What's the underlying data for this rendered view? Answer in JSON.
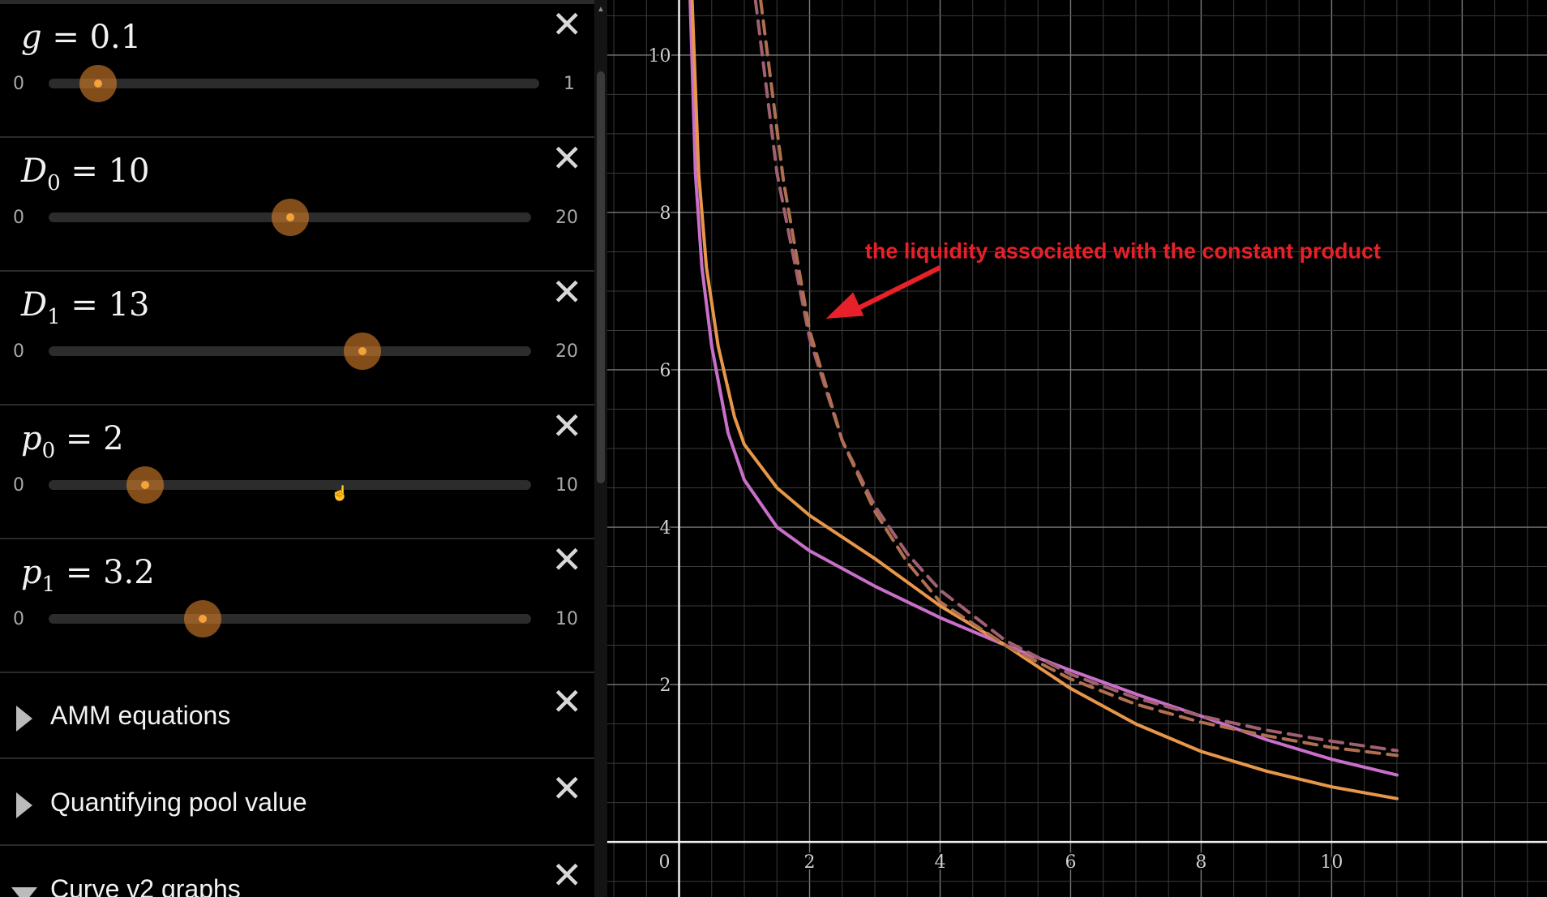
{
  "sliders": [
    {
      "var": "g",
      "sub": "",
      "value": "0.1",
      "min": "0",
      "max": "1",
      "level": 0.1
    },
    {
      "var": "D",
      "sub": "0",
      "value": "10",
      "min": "0",
      "max": "20",
      "level": 0.5
    },
    {
      "var": "D",
      "sub": "1",
      "value": "13",
      "min": "0",
      "max": "20",
      "level": 0.65
    },
    {
      "var": "p",
      "sub": "0",
      "value": "2",
      "min": "0",
      "max": "10",
      "level": 0.2
    },
    {
      "var": "p",
      "sub": "1",
      "value": "3.2",
      "min": "0",
      "max": "10",
      "level": 0.32
    }
  ],
  "folders": [
    {
      "title": "AMM equations",
      "expanded": false
    },
    {
      "title": "Quantifying pool value",
      "expanded": false
    },
    {
      "title": "Curve v2 graphs",
      "expanded": true
    }
  ],
  "icons": {
    "delete": "close-x-icon",
    "collapse": "triangle-icon",
    "cursor": "hand-cursor-icon"
  },
  "annotation": {
    "text": "the liquidity associated with the constant product",
    "color": "#e8202a"
  },
  "chart_data": {
    "type": "line",
    "xlim": [
      -1.1,
      13.3
    ],
    "ylim": [
      -0.7,
      10.7
    ],
    "x_ticks": [
      "0",
      "2",
      "4",
      "6",
      "8",
      "10"
    ],
    "y_ticks": [
      "2",
      "4",
      "6",
      "8",
      "10"
    ],
    "grid": true,
    "series": [
      {
        "color": "#c86fc9",
        "style": "solid",
        "points": [
          [
            0.17,
            10.7
          ],
          [
            0.25,
            8.5
          ],
          [
            0.35,
            7.3
          ],
          [
            0.5,
            6.3
          ],
          [
            0.75,
            5.2
          ],
          [
            1.0,
            4.6
          ],
          [
            1.5,
            4.0
          ],
          [
            2.0,
            3.7
          ],
          [
            3.0,
            3.25
          ],
          [
            4.0,
            2.85
          ],
          [
            5.0,
            2.5
          ],
          [
            6.0,
            2.18
          ],
          [
            7.0,
            1.88
          ],
          [
            8.0,
            1.6
          ],
          [
            9.0,
            1.3
          ],
          [
            10.0,
            1.05
          ],
          [
            11.0,
            0.85
          ]
        ]
      },
      {
        "color": "#e8974a",
        "style": "solid",
        "points": [
          [
            0.2,
            10.7
          ],
          [
            0.3,
            8.5
          ],
          [
            0.42,
            7.3
          ],
          [
            0.6,
            6.3
          ],
          [
            0.85,
            5.4
          ],
          [
            1.0,
            5.05
          ],
          [
            1.5,
            4.5
          ],
          [
            2.0,
            4.15
          ],
          [
            3.0,
            3.6
          ],
          [
            4.0,
            3.0
          ],
          [
            5.0,
            2.5
          ],
          [
            6.0,
            1.95
          ],
          [
            7.0,
            1.5
          ],
          [
            8.0,
            1.15
          ],
          [
            9.0,
            0.9
          ],
          [
            10.0,
            0.7
          ],
          [
            11.0,
            0.55
          ]
        ]
      },
      {
        "color": "#a06070",
        "style": "dashed",
        "points": [
          [
            1.17,
            10.7
          ],
          [
            1.5,
            8.5
          ],
          [
            2.0,
            6.4
          ],
          [
            2.5,
            5.1
          ],
          [
            3.0,
            4.27
          ],
          [
            3.5,
            3.66
          ],
          [
            4.0,
            3.2
          ],
          [
            5.0,
            2.56
          ],
          [
            6.0,
            2.13
          ],
          [
            7.0,
            1.83
          ],
          [
            8.0,
            1.6
          ],
          [
            9.0,
            1.42
          ],
          [
            10.0,
            1.28
          ],
          [
            11.0,
            1.16
          ]
        ]
      },
      {
        "color": "#b07050",
        "style": "dashed",
        "points": [
          [
            1.25,
            10.7
          ],
          [
            1.6,
            8.4
          ],
          [
            2.0,
            6.5
          ],
          [
            2.5,
            5.1
          ],
          [
            3.0,
            4.2
          ],
          [
            3.5,
            3.55
          ],
          [
            4.0,
            3.05
          ],
          [
            5.0,
            2.5
          ],
          [
            6.0,
            2.07
          ],
          [
            7.0,
            1.75
          ],
          [
            8.0,
            1.52
          ],
          [
            9.0,
            1.35
          ],
          [
            10.0,
            1.2
          ],
          [
            11.0,
            1.1
          ]
        ]
      }
    ]
  }
}
